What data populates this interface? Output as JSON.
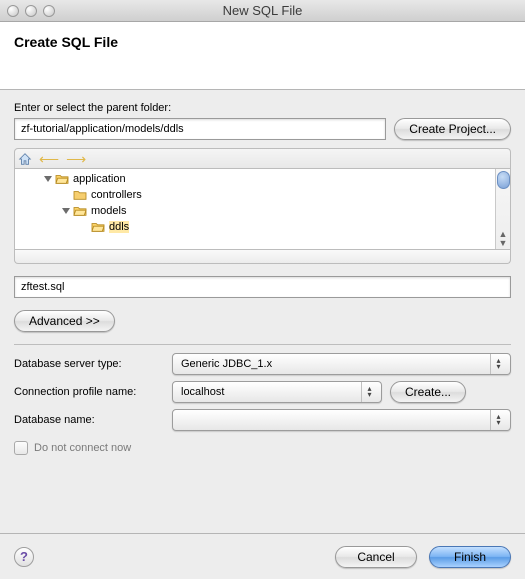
{
  "window": {
    "title": "New SQL File"
  },
  "banner": {
    "title": "Create SQL File"
  },
  "parent": {
    "label": "Enter or select the parent folder:",
    "value": "zf-tutorial/application/models/ddls",
    "createProject": "Create Project..."
  },
  "tree": {
    "items": [
      {
        "label": "application",
        "depth": 1,
        "expandable": true
      },
      {
        "label": "controllers",
        "depth": 2,
        "expandable": false
      },
      {
        "label": "models",
        "depth": 2,
        "expandable": true
      },
      {
        "label": "ddls",
        "depth": 3,
        "expandable": false,
        "selected": true
      }
    ]
  },
  "filename": {
    "value": "zftest.sql"
  },
  "advanced": {
    "label": "Advanced >>"
  },
  "db": {
    "serverTypeLabel": "Database server type:",
    "serverType": "Generic JDBC_1.x",
    "profileLabel": "Connection profile name:",
    "profile": "localhost",
    "createBtn": "Create...",
    "dbNameLabel": "Database name:",
    "dbName": "",
    "noConnectLabel": "Do not connect now",
    "noConnectChecked": false
  },
  "footer": {
    "help": "?",
    "cancel": "Cancel",
    "finish": "Finish"
  }
}
